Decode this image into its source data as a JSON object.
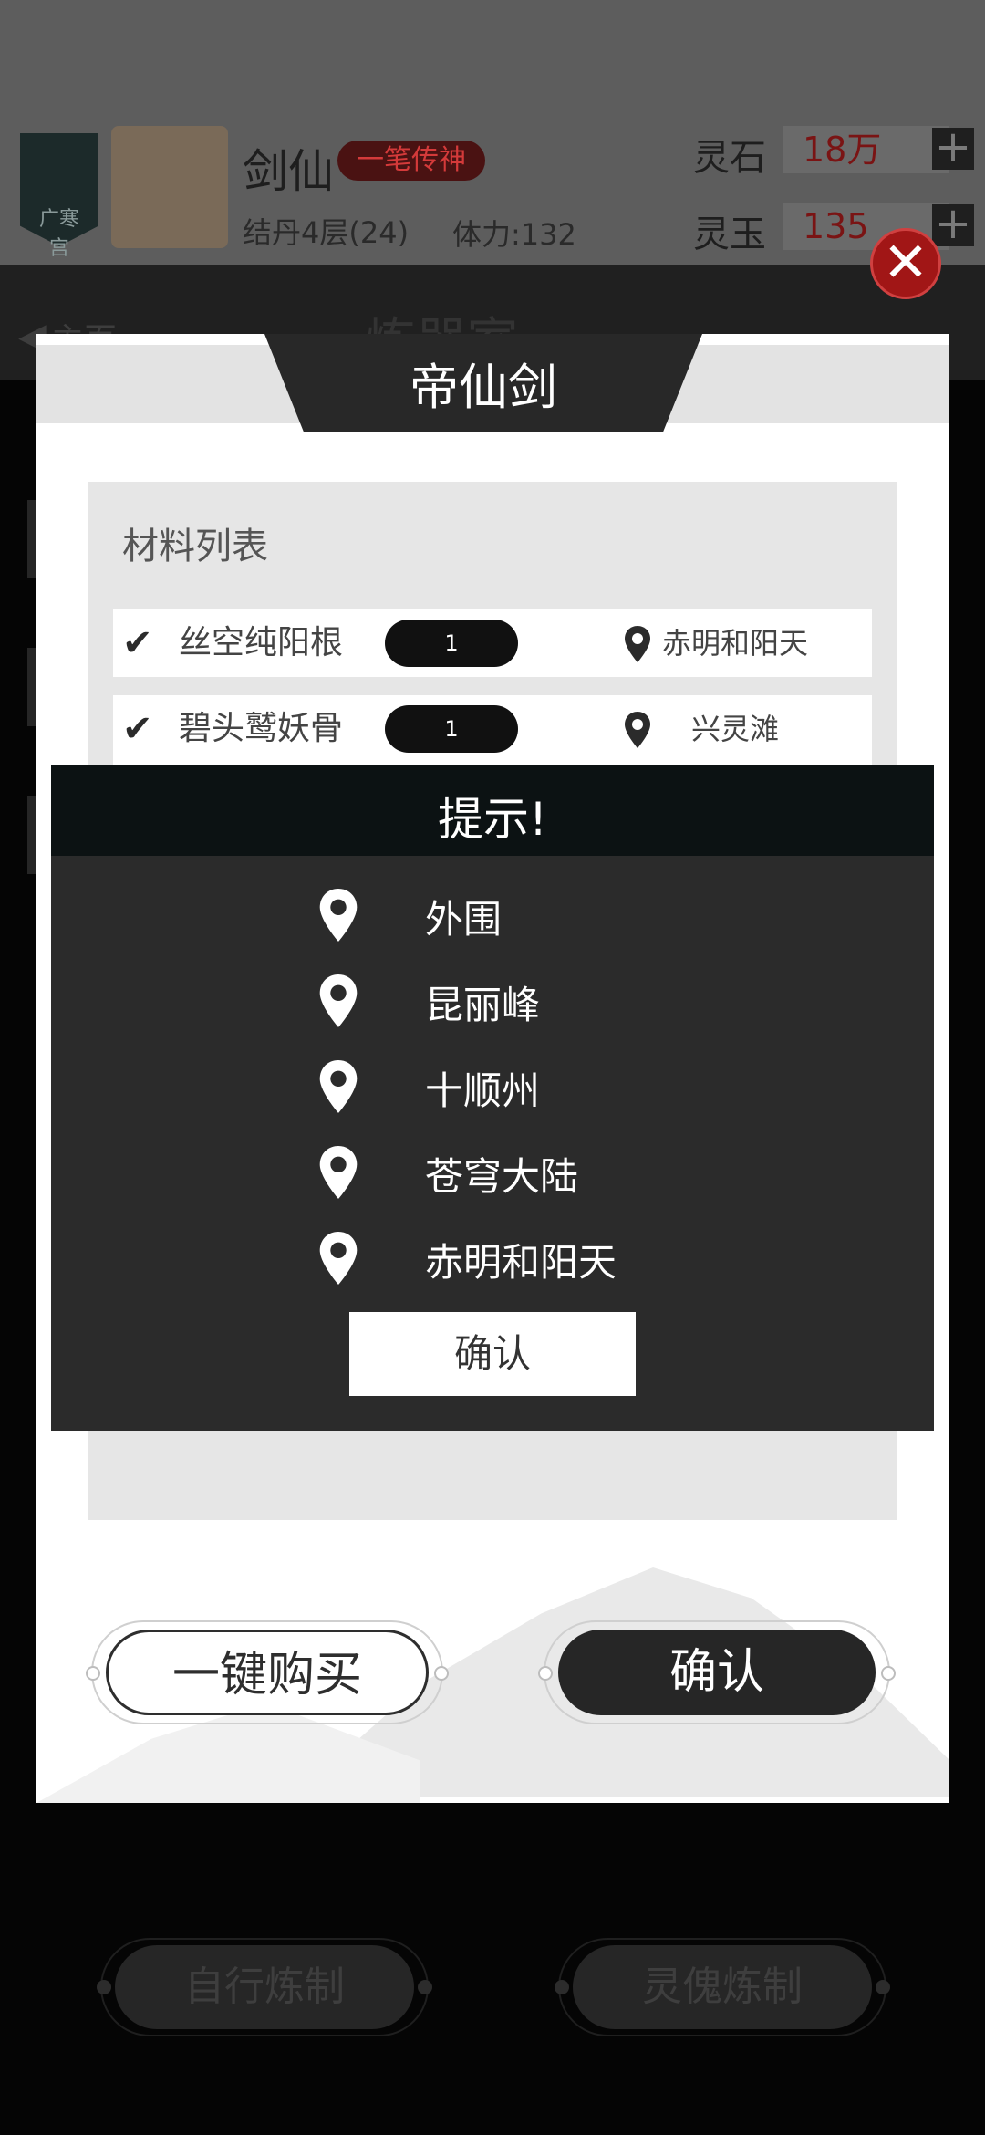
{
  "header": {
    "player_name": "剑仙",
    "title_tag": "一笔传神",
    "level": "结丹4层(24)",
    "stamina": "体力:132",
    "currencies": [
      {
        "label": "灵石",
        "value": "18万"
      },
      {
        "label": "灵玉",
        "value": "135"
      }
    ],
    "plus_symbol": "+",
    "badge_text": "广寒宫"
  },
  "subheader": {
    "back_label": "主页",
    "page_title": "炼器室"
  },
  "modal": {
    "title": "帝仙剑",
    "materials_heading": "材料列表",
    "materials": [
      {
        "name": "丝空纯阳根",
        "quantity": "1",
        "location": "赤明和阳天"
      },
      {
        "name": "碧头鹫妖骨",
        "quantity": "1",
        "location": "兴灵滩"
      }
    ],
    "buy_all_label": "一键购买",
    "confirm_label": "确认"
  },
  "hint_popup": {
    "title": "提示!",
    "locations": [
      "外围",
      "昆丽峰",
      "十顺州",
      "苍穹大陆",
      "赤明和阳天"
    ],
    "confirm_label": "确认"
  },
  "bottom_bar": {
    "self_craft_label": "自行炼制",
    "puppet_craft_label": "灵傀炼制"
  },
  "icons": {
    "check": "check-icon",
    "location": "location-pin-icon",
    "close": "close-icon",
    "plus": "plus-icon"
  },
  "colors": {
    "accent_red": "#a11616",
    "dark_panel": "#2b2b2b"
  }
}
